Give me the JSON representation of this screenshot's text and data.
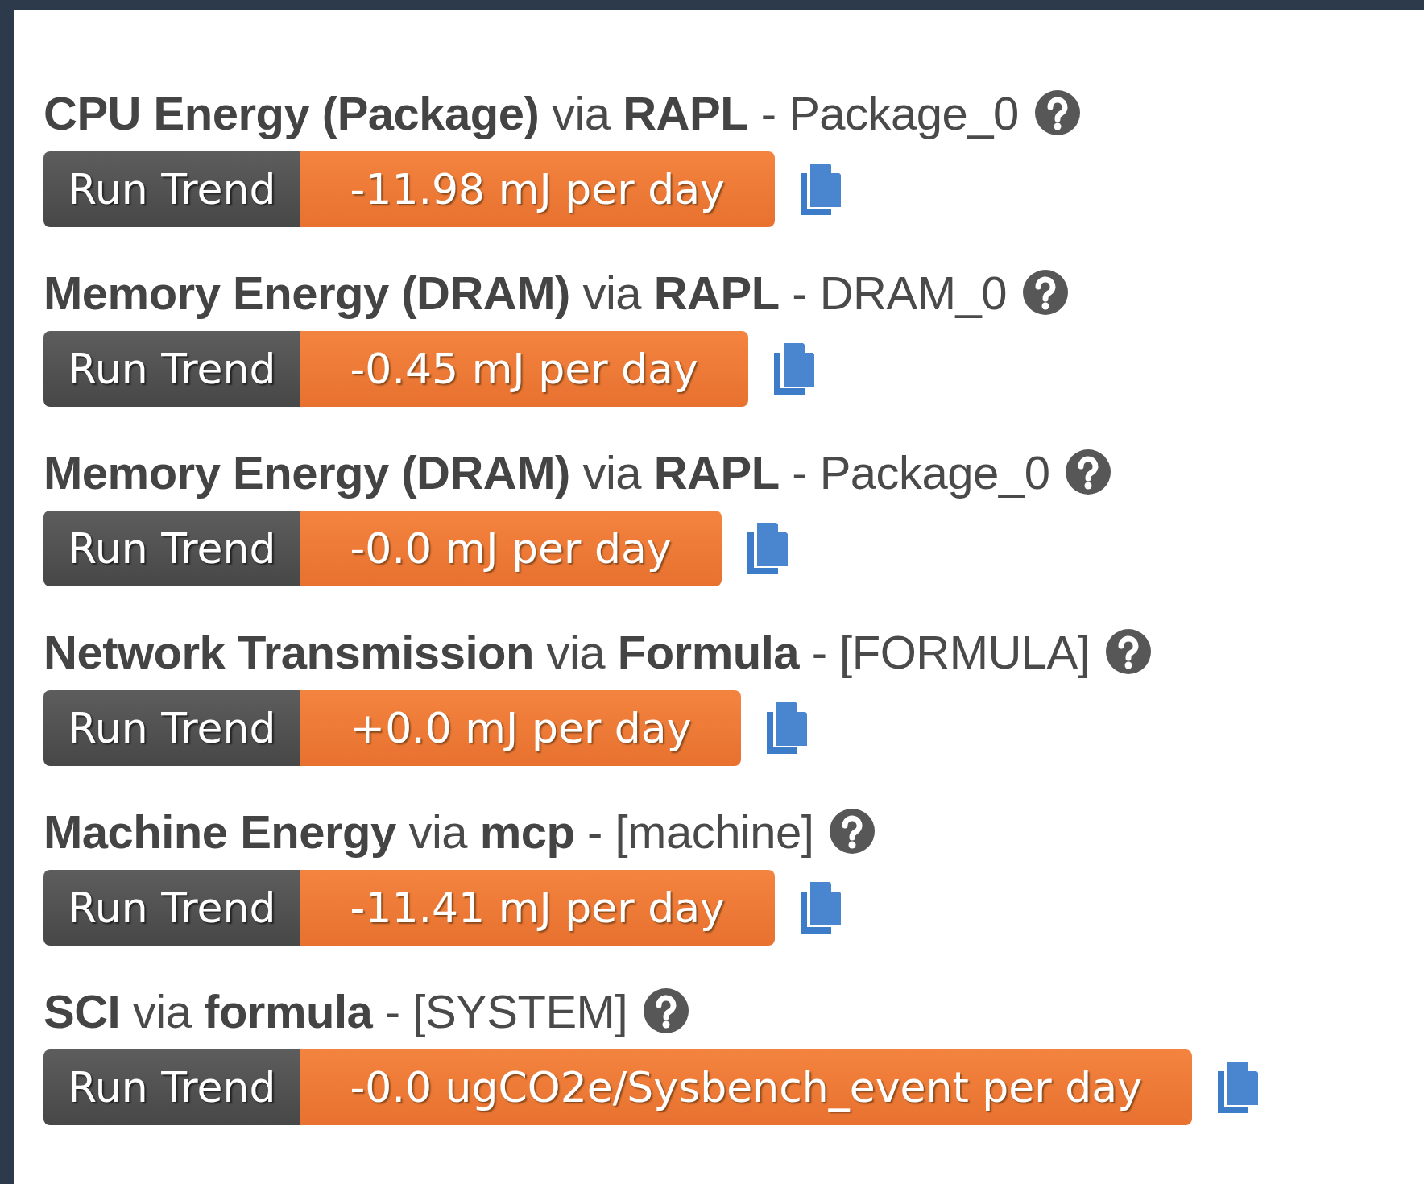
{
  "metrics": [
    {
      "title": "**CPU Energy (Package)** via **RAPL** - Package_0",
      "button": "Run Trend",
      "trend": "-11.98 mJ per day"
    },
    {
      "title": "**Memory Energy (DRAM)** via **RAPL** - DRAM_0",
      "button": "Run Trend",
      "trend": "-0.45 mJ per day"
    },
    {
      "title": "**Memory Energy (DRAM)** via **RAPL** - Package_0",
      "button": "Run Trend",
      "trend": "-0.0 mJ per day"
    },
    {
      "title": "**Network Transmission** via **Formula** - [FORMULA]",
      "button": "Run Trend",
      "trend": "+0.0 mJ per day"
    },
    {
      "title": "**Machine Energy** via **mcp** - [machine]",
      "button": "Run Trend",
      "trend": "-11.41 mJ per day"
    },
    {
      "title": "**SCI** via **formula** - [SYSTEM]",
      "button": "Run Trend",
      "trend": "-0.0 ugCO2e/Sysbench_event per day"
    }
  ]
}
